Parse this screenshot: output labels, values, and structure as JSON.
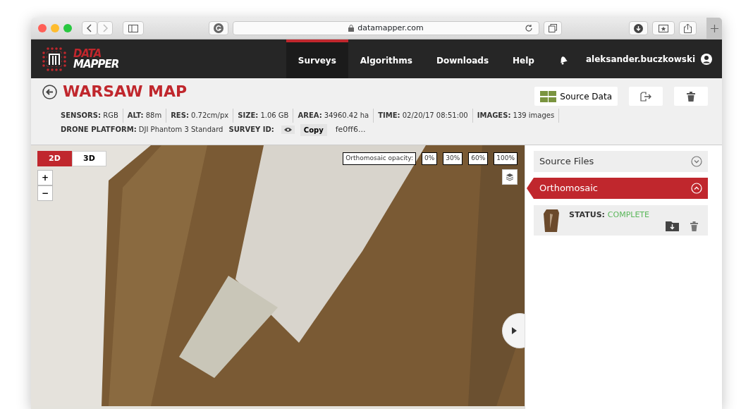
{
  "browser": {
    "url": "datamapper.com"
  },
  "logo": {
    "line_1": "DATA",
    "line_2": "MAPPER"
  },
  "nav": [
    {
      "label": "Surveys",
      "selected": true
    },
    {
      "label": "Algorithms",
      "selected": false
    },
    {
      "label": "Downloads",
      "selected": false
    },
    {
      "label": "Help",
      "selected": false
    }
  ],
  "user": {
    "name": "aleksander.buczkowski"
  },
  "survey": {
    "title": "WARSAW MAP",
    "actions": [
      {
        "kind": "source",
        "label": "Source Data"
      },
      {
        "kind": "export"
      },
      {
        "kind": "delete"
      }
    ],
    "meta": [
      {
        "label": "SENSORS:",
        "value": "RGB"
      },
      {
        "label": "ALT:",
        "value": "88m"
      },
      {
        "label": "RES:",
        "value": "0.72cm/px"
      },
      {
        "label": "SIZE:",
        "value": "1.06 GB"
      },
      {
        "label": "AREA:",
        "value": "34960.42 ha"
      },
      {
        "label": "TIME:",
        "value": "02/20/17 08:51:00"
      },
      {
        "label": "IMAGES:",
        "value": "139 images"
      }
    ],
    "platform": {
      "label": "DRONE PLATFORM:",
      "value": "DJI Phantom 3 Standard"
    },
    "survey_id": {
      "label": "SURVEY ID:",
      "copy": "Copy",
      "value": "fe0ff6..."
    }
  },
  "map": {
    "view_modes": [
      {
        "label": "2D",
        "selected": true
      },
      {
        "label": "3D",
        "selected": false
      }
    ],
    "zoom": [
      "+",
      "−"
    ],
    "opacity": {
      "label": "Orthomosaic opacity:",
      "options": [
        "0%",
        "30%",
        "60%",
        "100%"
      ]
    }
  },
  "panels": [
    {
      "title": "Source Files",
      "expanded": false
    },
    {
      "title": "Orthomosaic",
      "expanded": true,
      "status_label": "STATUS:",
      "status": "COMPLETE"
    }
  ]
}
